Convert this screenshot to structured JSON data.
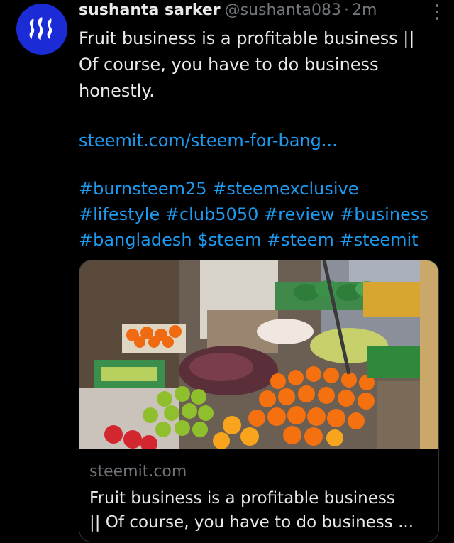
{
  "tweet": {
    "name": "sushanta sarker",
    "handle": "@sushanta083",
    "separator": "·",
    "time": "2m",
    "text_line1": "Fruit business is a profitable business ||",
    "text_line2": "Of course, you have to do business",
    "text_line3": "honestly.",
    "link": "steemit.com/steem-for-bang...",
    "hashtags": [
      "#burnsteem25",
      "#steemexclusive",
      "#lifestyle",
      "#club5050",
      "#review",
      "#business",
      "#bangladesh",
      "$steem",
      "#steem",
      "#steemit"
    ]
  },
  "card": {
    "domain": "steemit.com",
    "title_line1": "Fruit business is a profitable business",
    "title_line2": "|| Of course, you have to do business ..."
  },
  "icons": {
    "avatar": "steem-logo-icon",
    "more": "more-options-icon"
  },
  "colors": {
    "background": "#000000",
    "link": "#1d9bf0",
    "muted": "#71767b",
    "avatar": "#1b2bd6"
  }
}
